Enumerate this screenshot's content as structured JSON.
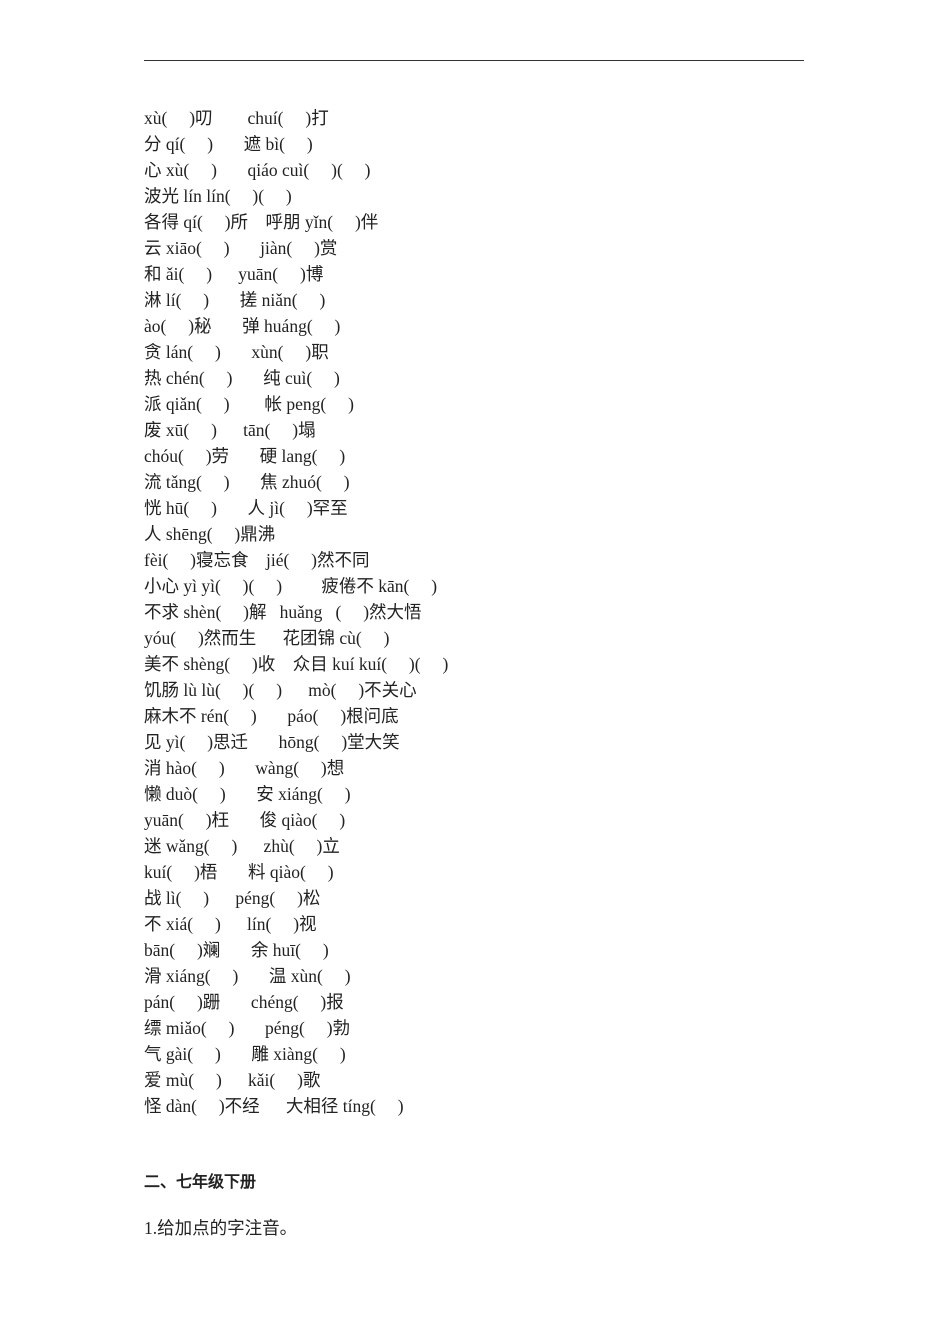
{
  "lines": [
    "xù(     )叨        chuí(     )打",
    "分 qí(     )       遮 bì(     )",
    "心 xù(     )       qiáo cuì(     )(     )",
    "波光 lín lín(     )(     )",
    "各得 qí(     )所    呼朋 yǐn(     )伴",
    "云 xiāo(     )       jiàn(     )赏",
    "和 ǎi(     )      yuān(     )博",
    "淋 lí(     )       搓 niǎn(     )",
    "ào(     )秘       弹 huáng(     )",
    "贪 lán(     )       xùn(     )职",
    "热 chén(     )       纯 cuì(     )",
    "派 qiǎn(     )        帐 peng(     )",
    "废 xū(     )      tān(     )塌",
    "chóu(     )劳       硬 lang(     )",
    "流 tǎng(     )       焦 zhuó(     )",
    "恍 hū(     )       人 jì(     )罕至",
    "人 shēng(     )鼎沸",
    "fèi(     )寝忘食    jié(     )然不同",
    "小心 yì yì(     )(     )         疲倦不 kān(     )",
    "不求 shèn(     )解   huǎng   (     )然大悟",
    "yóu(     )然而生      花团锦 cù(     )",
    "美不 shèng(     )收    众目 kuí kuí(     )(     )",
    "饥肠 lù lù(     )(     )      mò(     )不关心",
    "麻木不 rén(     )       páo(     )根问底",
    "见 yì(     )思迁       hōng(     )堂大笑",
    "消 hào(     )       wàng(     )想",
    "懒 duò(     )       安 xiáng(     )",
    "yuān(     )枉       俊 qiào(     )",
    "迷 wǎng(     )      zhù(     )立",
    "kuí(     )梧       料 qiào(     )",
    "战 lì(     )      péng(     )松",
    "不 xiá(     )      lín(     )视",
    "bān(     )斓       余 huī(     )",
    "滑 xiáng(     )       温 xùn(     )",
    "pán(     )跚       chéng(     )报",
    "缥 miǎo(     )       péng(     )勃",
    "气 gài(     )       雕 xiàng(     )",
    "爱 mù(     )      kǎi(     )歌",
    "怪 dàn(     )不经      大相径 tíng(     )"
  ],
  "section_title": "二、七年级下册",
  "instruction": "1.给加点的字注音。"
}
